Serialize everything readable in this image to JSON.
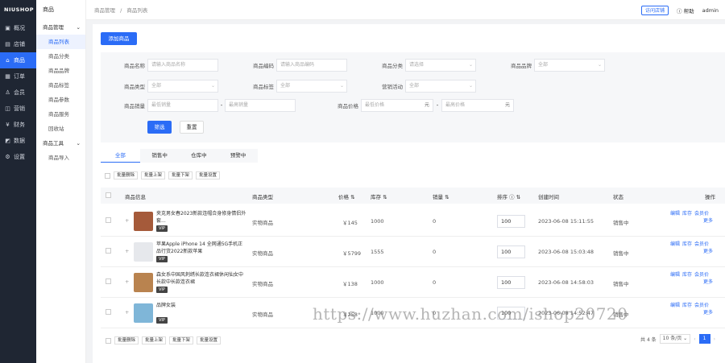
{
  "app": {
    "logo": "NIUSHOP"
  },
  "sidebar": {
    "items": [
      {
        "label": "概况",
        "icon": "overview-icon",
        "glyph": "▣"
      },
      {
        "label": "店铺",
        "icon": "store-icon",
        "glyph": "▤"
      },
      {
        "label": "商品",
        "icon": "goods-icon",
        "glyph": "⌂",
        "active": true
      },
      {
        "label": "订单",
        "icon": "order-icon",
        "glyph": "▦"
      },
      {
        "label": "会员",
        "icon": "member-icon",
        "glyph": "♙"
      },
      {
        "label": "营销",
        "icon": "marketing-icon",
        "glyph": "◫"
      },
      {
        "label": "财务",
        "icon": "finance-icon",
        "glyph": "¥"
      },
      {
        "label": "数据",
        "icon": "data-icon",
        "glyph": "◩"
      },
      {
        "label": "设置",
        "icon": "settings-icon",
        "glyph": "⚙"
      }
    ]
  },
  "subnav": {
    "head": "商品",
    "group1": "商品管理",
    "items": [
      "商品列表",
      "商品分类",
      "商品品牌",
      "商品标签",
      "商品参数",
      "商品服务",
      "回收站"
    ],
    "group2": "商品工具",
    "tool_items": [
      "商品导入"
    ]
  },
  "topbar": {
    "crumb1": "商品管理",
    "crumb_sep": "/",
    "crumb2": "商品列表",
    "visit_store": "访问店铺",
    "help": "帮助",
    "user": "admin"
  },
  "toolbar": {
    "add_label": "添加商品"
  },
  "filter": {
    "name_label": "商品名称",
    "name_placeholder": "请输入商品名称",
    "code_label": "商品编码",
    "code_placeholder": "请输入商品编码",
    "cat_label": "商品分类",
    "cat_value": "请选择",
    "brand_label": "商品品牌",
    "brand_value": "全部",
    "type_label": "商品类型",
    "type_value": "全部",
    "tag_label": "商品标签",
    "tag_value": "全部",
    "promo_label": "营销活动",
    "promo_value": "全部",
    "sales_label": "商品销量",
    "sales_min": "最低销量",
    "sales_max": "最高销量",
    "price_label": "商品价格",
    "price_min": "最低价格",
    "price_max": "最高价格",
    "price_unit": "元",
    "filter_btn": "筛选",
    "reset_btn": "重置"
  },
  "tabs": [
    {
      "label": "全部",
      "active": true
    },
    {
      "label": "销售中"
    },
    {
      "label": "仓库中"
    },
    {
      "label": "预警中"
    }
  ],
  "batch": [
    "批量删除",
    "批量上架",
    "批量下架",
    "批量设置"
  ],
  "table": {
    "headers": {
      "info": "商品信息",
      "type": "商品类型",
      "price": "价格",
      "stock": "库存",
      "sales": "销量",
      "sort": "排序",
      "created": "创建时间",
      "status": "状态",
      "ops": "操作"
    },
    "rows": [
      {
        "name": "夹克男女春2023新款连帽合身修身情侣外套...",
        "type": "实物商品",
        "price": "￥145",
        "stock": "1000",
        "sales": "0",
        "sort": "100",
        "created": "2023-06-08 15:11:55",
        "status": "销售中",
        "ops": [
          "编辑",
          "库存",
          "会员价",
          "更多"
        ],
        "thumb": "#a55a3a"
      },
      {
        "name": "苹果Apple iPhone 14 全网通5G手机正品行货2022新款苹果",
        "type": "实物商品",
        "price": "￥5799",
        "stock": "1555",
        "sales": "0",
        "sort": "100",
        "created": "2023-06-08 15:03:48",
        "status": "销售中",
        "ops": [
          "编辑",
          "库存",
          "会员价",
          "更多"
        ],
        "thumb": "#e6e8ec"
      },
      {
        "name": "森女系中国风刺绣长款连衣裙休闲仙女中长款中长款连衣裙",
        "type": "实物商品",
        "price": "￥138",
        "stock": "1000",
        "sales": "0",
        "sort": "100",
        "created": "2023-06-08 14:58:03",
        "status": "销售中",
        "ops": [
          "编辑",
          "库存",
          "会员价",
          "更多"
        ],
        "thumb": "#b9834f"
      },
      {
        "name": "品牌女装",
        "type": "实物商品",
        "price": "￥258",
        "stock": "1000",
        "sales": "0",
        "sort": "100",
        "created": "2023-06-08 14:52:47",
        "status": "销售中",
        "ops": [
          "编辑",
          "库存",
          "会员价",
          "更多"
        ],
        "thumb": "#7fb6d8"
      }
    ],
    "vip": "VIP"
  },
  "footer": {
    "actions": [
      "批量删除",
      "批量上架",
      "批量下架",
      "批量设置"
    ],
    "total": "共 4 条",
    "page_size": "10 条/页",
    "page": "1",
    "prev": "‹",
    "next": "›"
  },
  "watermark": "https://www.huzhan.com/ishop20720",
  "colors": {
    "accent": "#2b6cf6",
    "sidebar": "#1f2633"
  }
}
